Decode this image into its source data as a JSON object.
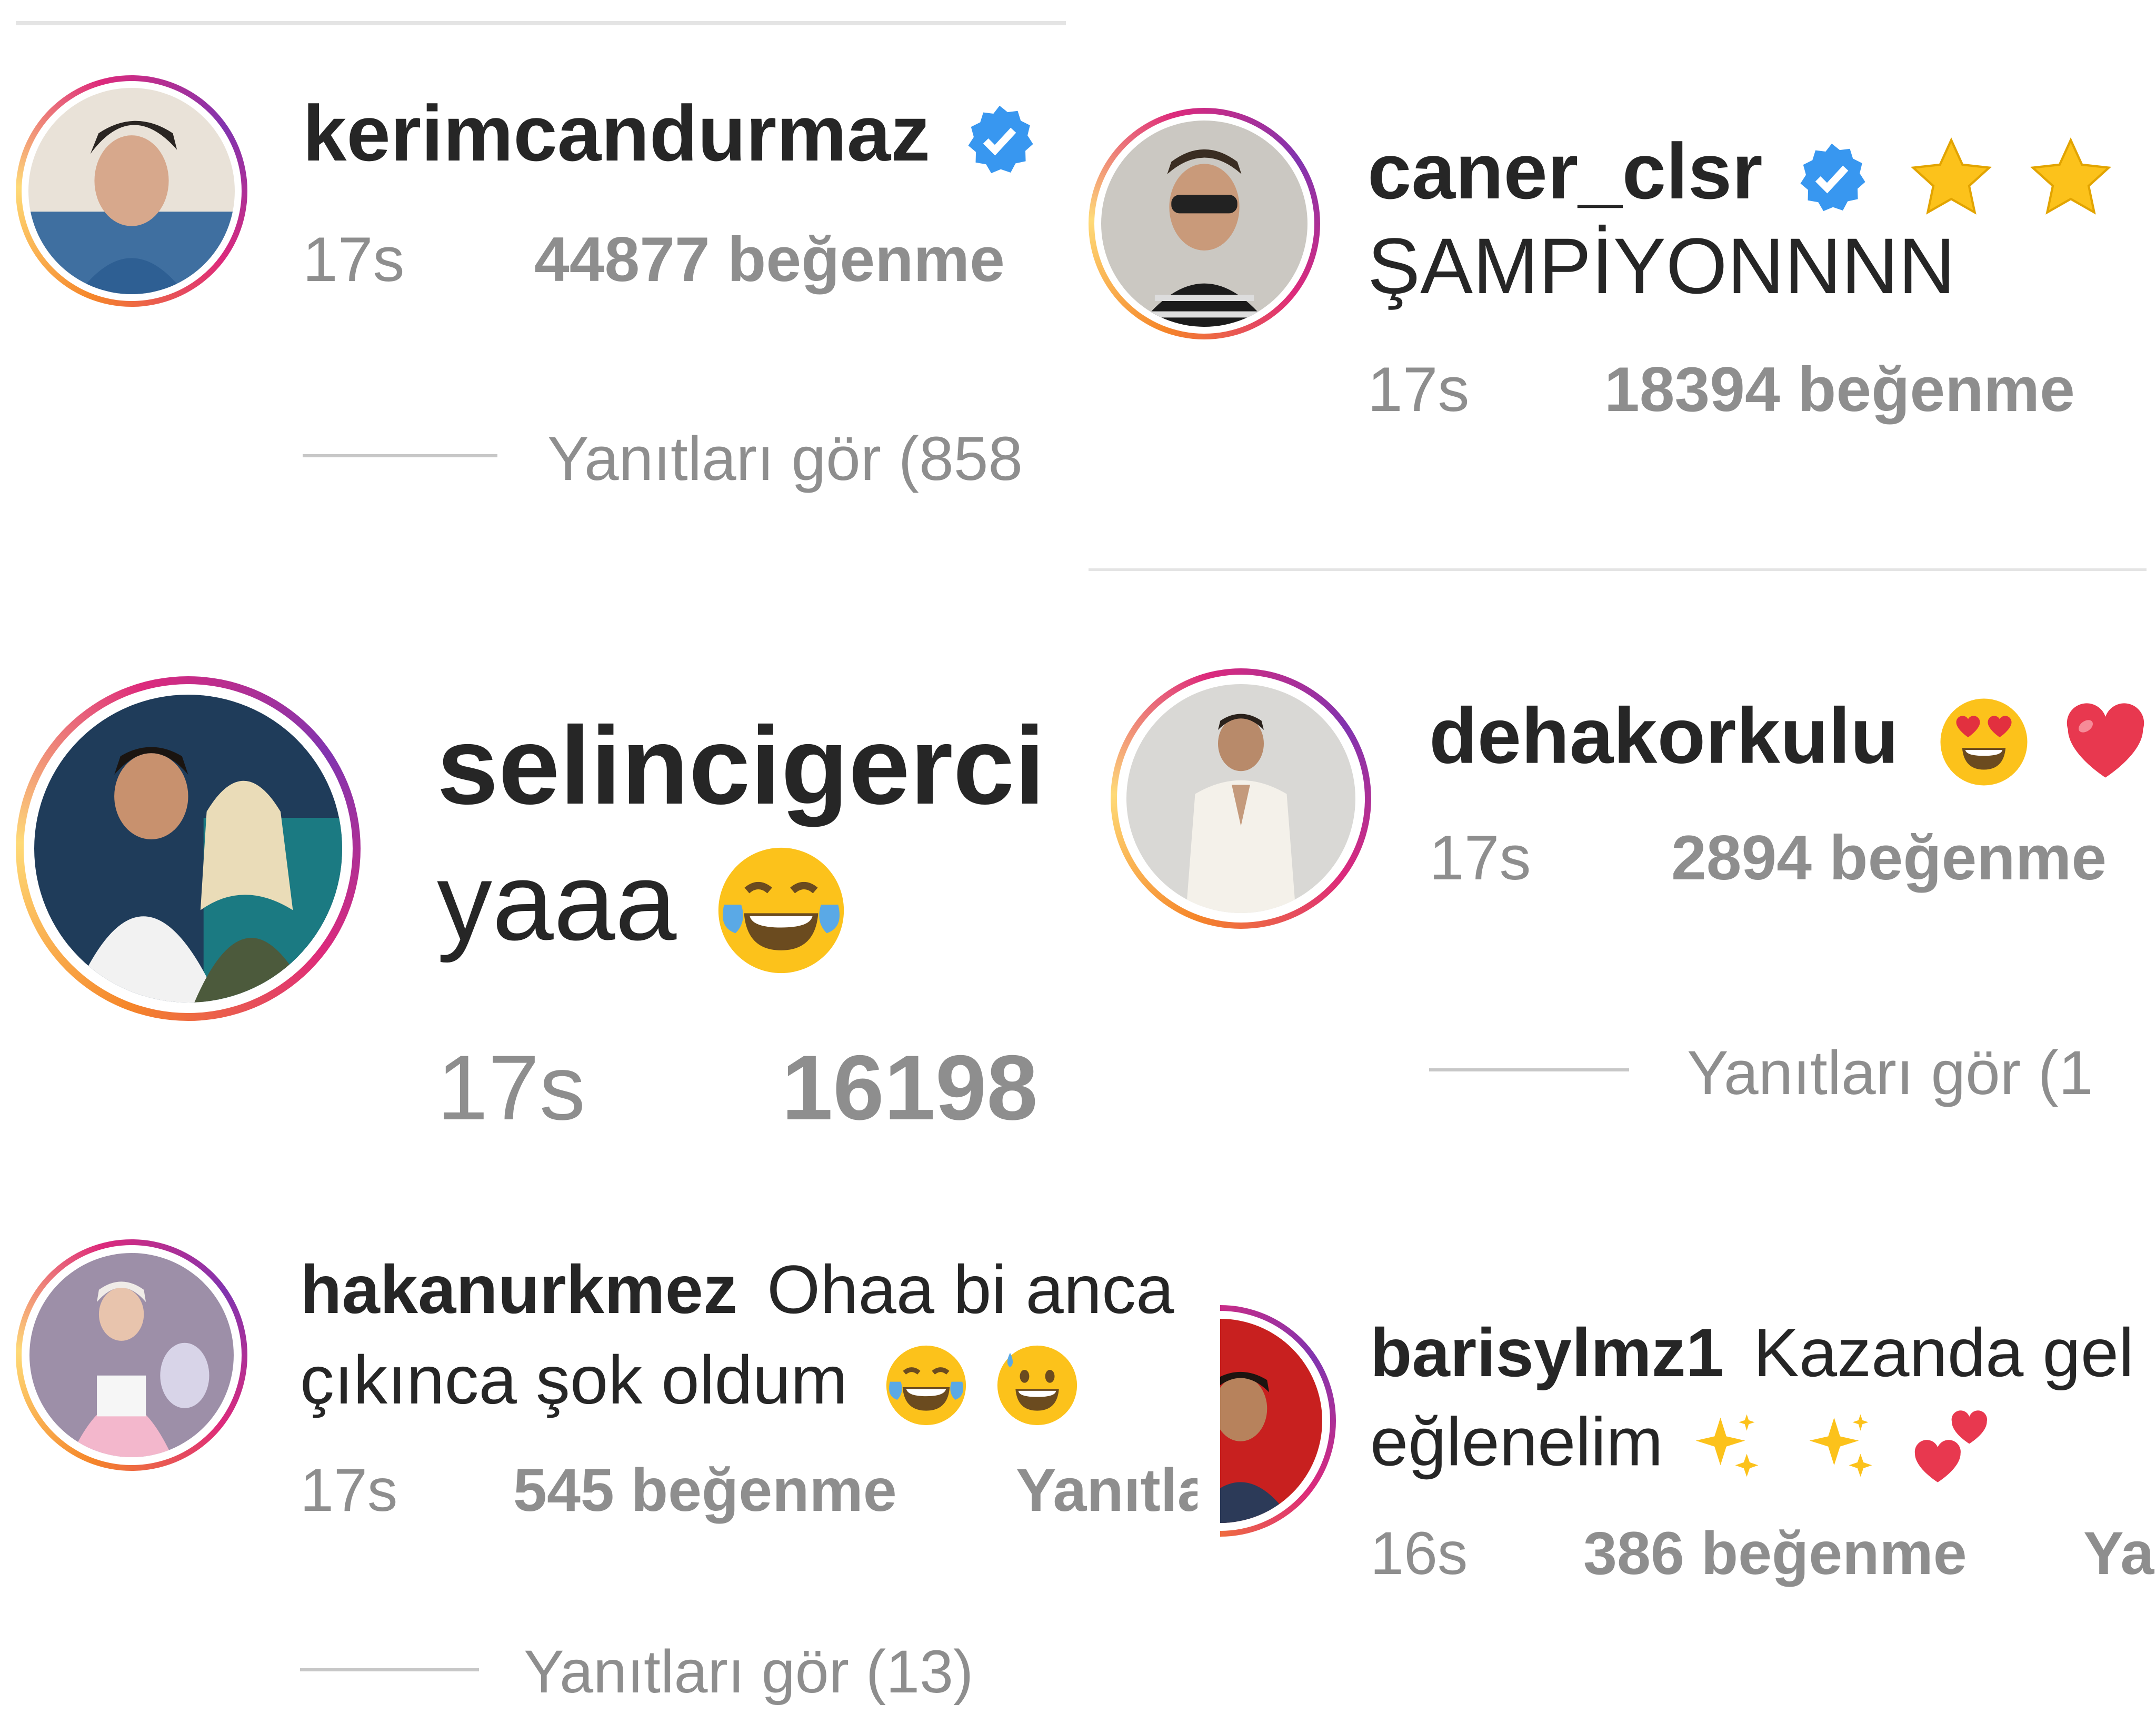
{
  "comments": [
    {
      "id": "kerim",
      "username": "kerimcandurmaz",
      "verified": true,
      "text": "",
      "time": "17s",
      "likes": "44877 beğenme",
      "replies": "Yanıtları gör (858"
    },
    {
      "id": "caner",
      "username": "caner_clsr",
      "verified": true,
      "text": "ŞAMPİYONNNN",
      "time": "17s",
      "likes": "18394 beğenme",
      "replies": ""
    },
    {
      "id": "selin",
      "username": "selincigerci",
      "verified": false,
      "text": "yaaa",
      "time": "17s",
      "likes": "16198",
      "replies": ""
    },
    {
      "id": "deha",
      "username": "dehakorkulu",
      "verified": false,
      "text": "",
      "time": "17s",
      "likes": "2894 beğenme",
      "replies": "Yanıtları gör (1"
    },
    {
      "id": "hakan",
      "username": "hakanurkmez",
      "verified": false,
      "text_line1": "Ohaa bi anca",
      "text_line2": "çıkınca şok oldum",
      "time": "17s",
      "likes": "545 beğenme",
      "reply": "Yanıtla",
      "replies": "Yanıtları gör (13)"
    },
    {
      "id": "baris",
      "username": "barisylmz1",
      "verified": false,
      "text_line1": "Kazanda gel",
      "text_line2": "eğlenelim",
      "time": "16s",
      "likes": "386 beğenme",
      "reply": "Ya",
      "replies": ""
    }
  ],
  "icons": {
    "verified": "verified-badge-icon",
    "emoji_tears_of_joy": "face-with-tears-of-joy-emoji",
    "emoji_heart_eyes": "smiling-face-with-heart-eyes-emoji",
    "emoji_heart": "red-heart-emoji",
    "emoji_sweat_smile": "grinning-face-with-sweat-emoji",
    "emoji_sparkles": "sparkles-emoji",
    "emoji_two_hearts": "two-hearts-emoji",
    "emoji_star": "star-emoji",
    "emoji_purple_heart": "purple-heart-emoji"
  },
  "colors": {
    "username": "#262626",
    "meta_gray": "#8e8e8e",
    "verified_blue": "#3897f0",
    "divider": "#c7c7c7"
  }
}
